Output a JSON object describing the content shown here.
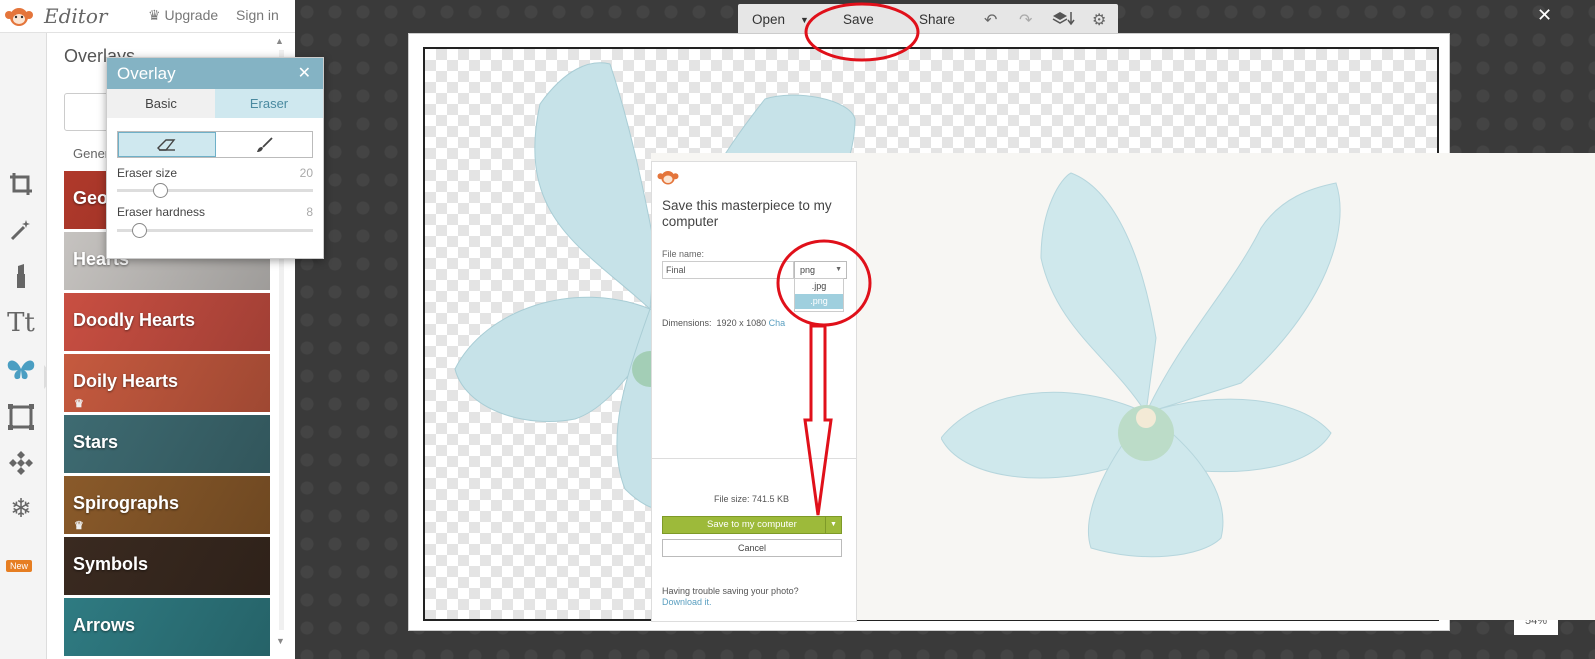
{
  "app": {
    "title": "Editor",
    "upgrade_label": "Upgrade",
    "signin_label": "Sign in"
  },
  "sidebar": {
    "panel_title": "Overlays",
    "general_label": "Gener",
    "new_badge": "New",
    "categories": [
      {
        "label": "Geo",
        "color": "#b0392b",
        "premium": false
      },
      {
        "label": "Hearts",
        "color": "#c6c3c0",
        "premium": false
      },
      {
        "label": "Doodly Hearts",
        "color": "#c94f42",
        "premium": false
      },
      {
        "label": "Doily Hearts",
        "color": "#c65a3f",
        "premium": true
      },
      {
        "label": "Stars",
        "color": "#3e6b72",
        "premium": false
      },
      {
        "label": "Spirographs",
        "color": "#8a5a2a",
        "premium": true
      },
      {
        "label": "Symbols",
        "color": "#3a2a20",
        "premium": false
      },
      {
        "label": "Arrows",
        "color": "#2f7b82",
        "premium": false
      }
    ]
  },
  "overlay_dialog": {
    "title": "Overlay",
    "close": "✕",
    "tabs": [
      "Basic",
      "Eraser"
    ],
    "active_tab": "Eraser",
    "eraser_size_label": "Eraser size",
    "eraser_size_value": "20",
    "eraser_hardness_label": "Eraser hardness",
    "eraser_hardness_value": "8"
  },
  "toolbar": {
    "open_label": "Open",
    "save_label": "Save",
    "share_label": "Share"
  },
  "canvas": {
    "zoom": "54%"
  },
  "save_dialog": {
    "title": "Save this masterpiece to my computer",
    "file_name_label": "File name:",
    "file_name_value": "Final",
    "format_selected": "png",
    "format_options": [
      ".jpg",
      ".png"
    ],
    "dimensions_label": "Dimensions:",
    "dimensions_value": "1920 x 1080",
    "change_link": "Cha",
    "file_size": "File size: 741.5 KB",
    "save_button": "Save to my computer",
    "cancel_button": "Cancel",
    "trouble_text": "Having trouble saving your photo?",
    "download_link": "Download it."
  }
}
